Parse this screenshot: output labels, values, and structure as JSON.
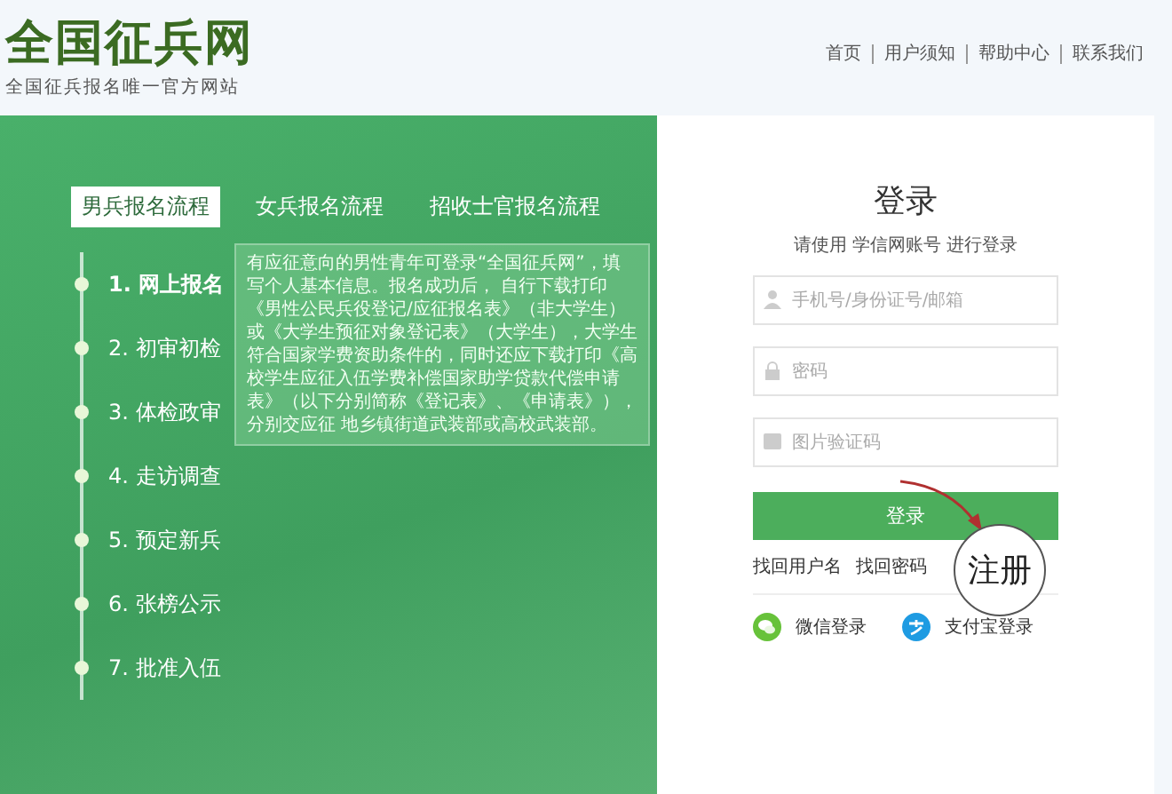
{
  "header": {
    "logo": "全国征兵网",
    "slogan": "全国征兵报名唯一官方网站",
    "nav": [
      "首页",
      "用户须知",
      "帮助中心",
      "联系我们"
    ]
  },
  "process": {
    "tabs": [
      {
        "label": "男兵报名流程",
        "selected": true
      },
      {
        "label": "女兵报名流程",
        "selected": false
      },
      {
        "label": "招收士官报名流程",
        "selected": false
      }
    ],
    "steps": [
      {
        "label": "1. 网上报名",
        "selected": true
      },
      {
        "label": "2. 初审初检",
        "selected": false
      },
      {
        "label": "3. 体检政审",
        "selected": false
      },
      {
        "label": "4. 走访调查",
        "selected": false
      },
      {
        "label": "5. 预定新兵",
        "selected": false
      },
      {
        "label": "6. 张榜公示",
        "selected": false
      },
      {
        "label": "7. 批准入伍",
        "selected": false
      }
    ],
    "tooltip": "有应征意向的男性青年可登录“全国征兵网”，填写个人基本信息。报名成功后， 自行下载打印《男性公民兵役登记/应征报名表》（非大学生）或《大学生预征对象登记表》（大学生），大学生符合国家学费资助条件的，同时还应下载打印《高校学生应征入伍学费补偿国家助学贷款代偿申请表》（以下分别简称《登记表》、《申请表》），分别交应征 地乡镇街道武装部或高校武装部。"
  },
  "login": {
    "title": "登录",
    "subtitle": "请使用 学信网账号 进行登录",
    "fields": [
      {
        "kind": "user",
        "placeholder": "手机号/身份证号/邮箱"
      },
      {
        "kind": "password",
        "placeholder": "密码"
      },
      {
        "kind": "captcha",
        "placeholder": "图片验证码"
      }
    ],
    "button": "登录",
    "links": [
      "找回用户名",
      "找回密码"
    ],
    "social": [
      {
        "kind": "wechat",
        "label": "微信登录"
      },
      {
        "kind": "alipay",
        "label": "支付宝登录"
      }
    ],
    "annotation": "注册"
  }
}
